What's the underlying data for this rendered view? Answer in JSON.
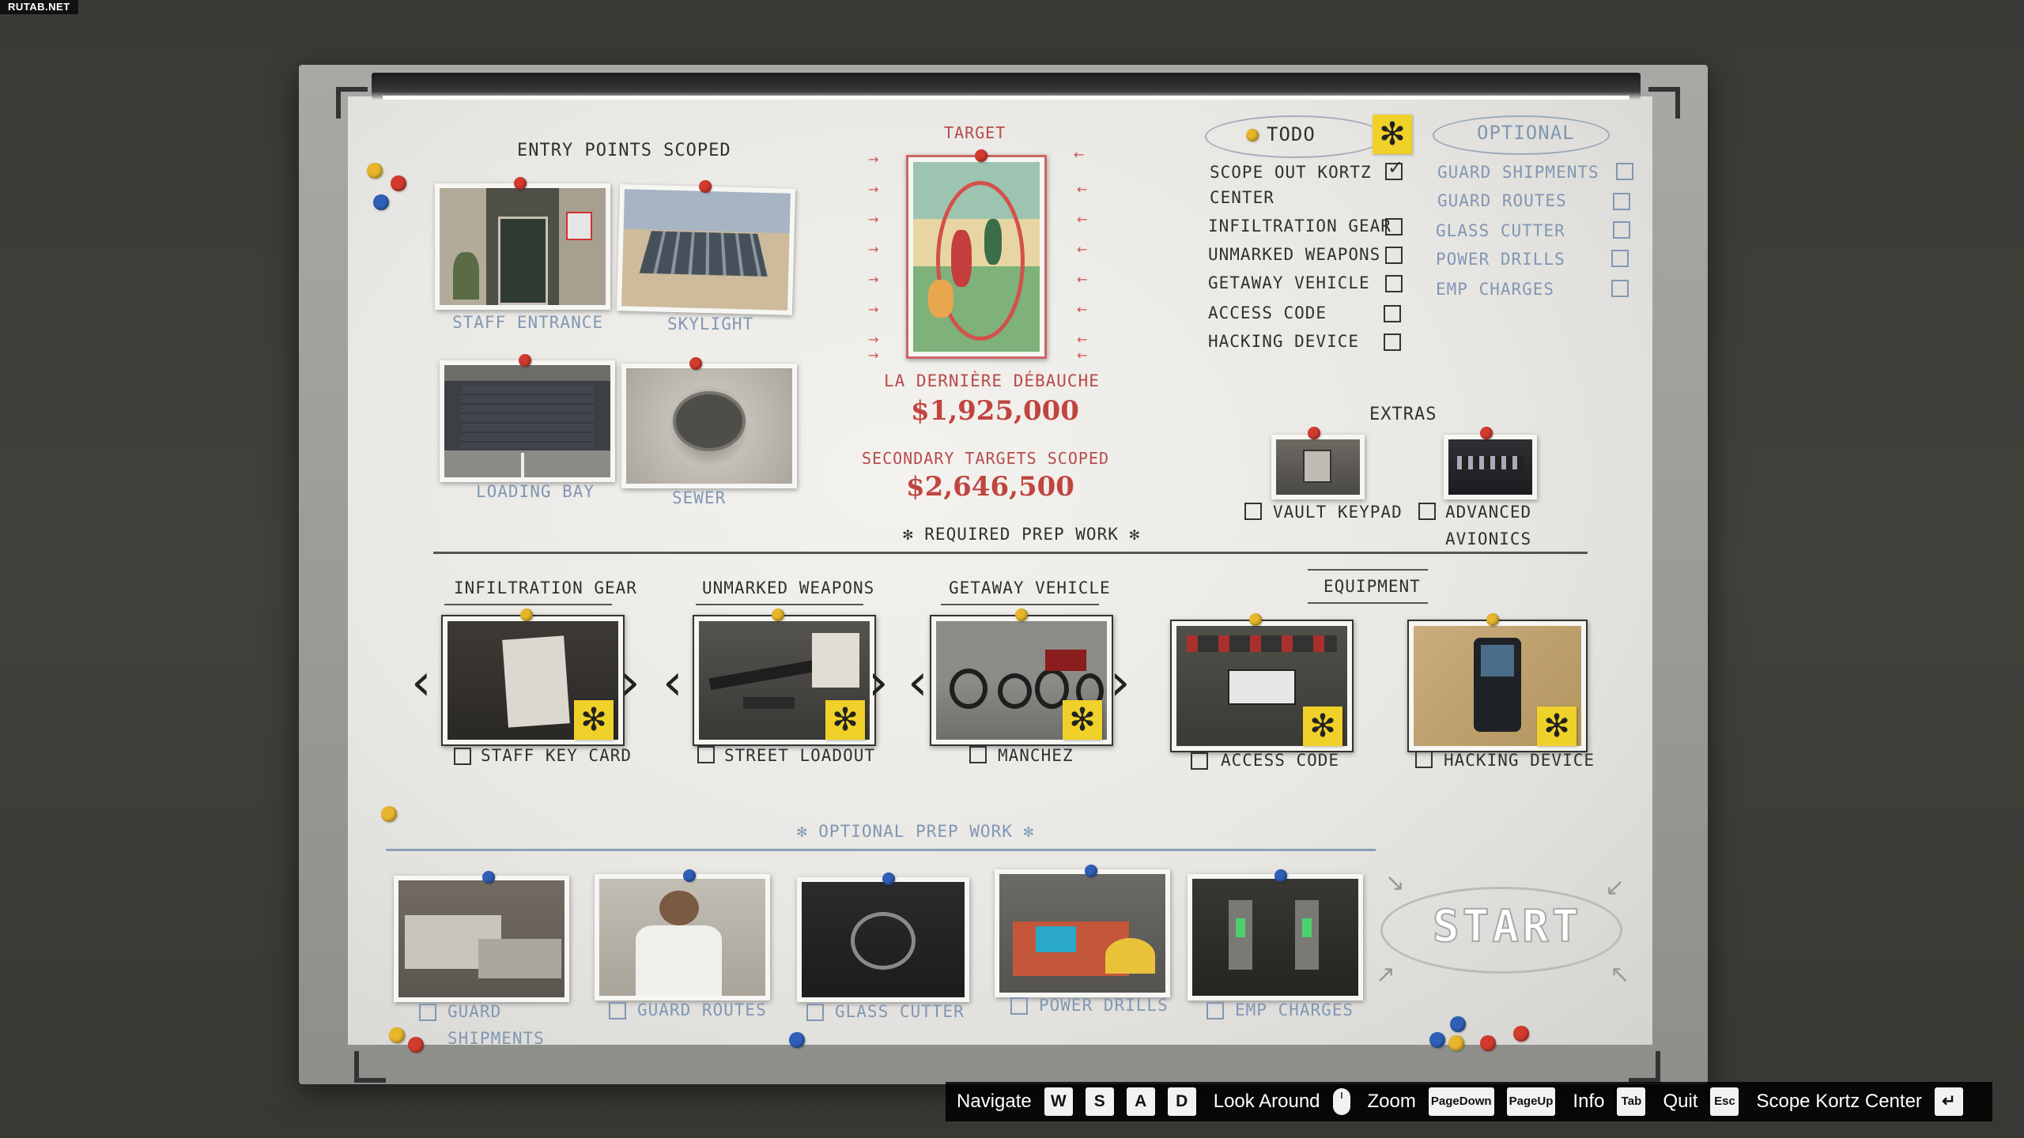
{
  "watermark": "RUTAB.NET",
  "board": {
    "entry": {
      "title": "ENTRY POINTS SCOPED",
      "items": [
        "STAFF ENTRANCE",
        "SKYLIGHT",
        "LOADING BAY",
        "SEWER"
      ]
    },
    "target": {
      "label": "TARGET",
      "name": "LA DERNIÈRE DÉBAUCHE",
      "value": "$1,925,000",
      "secondary_label": "SECONDARY TARGETS SCOPED",
      "secondary_value": "$2,646,500"
    },
    "todo": {
      "title": "TODO",
      "items": [
        {
          "label": "SCOPE OUT KORTZ",
          "label2": "CENTER",
          "checked": true
        },
        {
          "label": "INFILTRATION GEAR",
          "checked": false
        },
        {
          "label": "UNMARKED WEAPONS",
          "checked": false
        },
        {
          "label": "GETAWAY VEHICLE",
          "checked": false
        },
        {
          "label": "ACCESS CODE",
          "checked": false
        },
        {
          "label": "HACKING DEVICE",
          "checked": false
        }
      ]
    },
    "optional": {
      "title": "OPTIONAL",
      "items": [
        "GUARD SHIPMENTS",
        "GUARD ROUTES",
        "GLASS CUTTER",
        "POWER DRILLS",
        "EMP CHARGES"
      ]
    },
    "extras": {
      "title": "EXTRAS",
      "items": [
        {
          "label": "VAULT KEYPAD"
        },
        {
          "label": "ADVANCED",
          "label2": "AVIONICS"
        }
      ]
    },
    "required": {
      "title": "✻ REQUIRED PREP WORK ✻",
      "groups": [
        {
          "heading": "INFILTRATION GEAR",
          "item": "STAFF KEY CARD"
        },
        {
          "heading": "UNMARKED WEAPONS",
          "item": "STREET LOADOUT"
        },
        {
          "heading": "GETAWAY VEHICLE",
          "item": "MANCHEZ"
        },
        {
          "item": "ACCESS CODE"
        },
        {
          "item": "HACKING DEVICE"
        }
      ],
      "equipment_heading": "EQUIPMENT"
    },
    "optional_prep": {
      "title": "✻ OPTIONAL PREP WORK ✻",
      "items": [
        {
          "label": "GUARD",
          "label2": "SHIPMENTS"
        },
        {
          "label": "GUARD ROUTES"
        },
        {
          "label": "GLASS CUTTER"
        },
        {
          "label": "POWER DRILLS"
        },
        {
          "label": "EMP CHARGES"
        }
      ]
    },
    "start_label": "START",
    "star_glyph": "✻"
  },
  "hud": {
    "navigate": "Navigate",
    "keys_nav": [
      "W",
      "S",
      "A",
      "D"
    ],
    "look": "Look Around",
    "zoom": "Zoom",
    "zoom_keys": [
      [
        "Page",
        "Down"
      ],
      [
        "Page",
        "Up"
      ]
    ],
    "info": "Info",
    "info_key": "Tab",
    "quit": "Quit",
    "quit_key": "Esc",
    "action": "Scope Kortz Center",
    "action_key": "↵"
  }
}
